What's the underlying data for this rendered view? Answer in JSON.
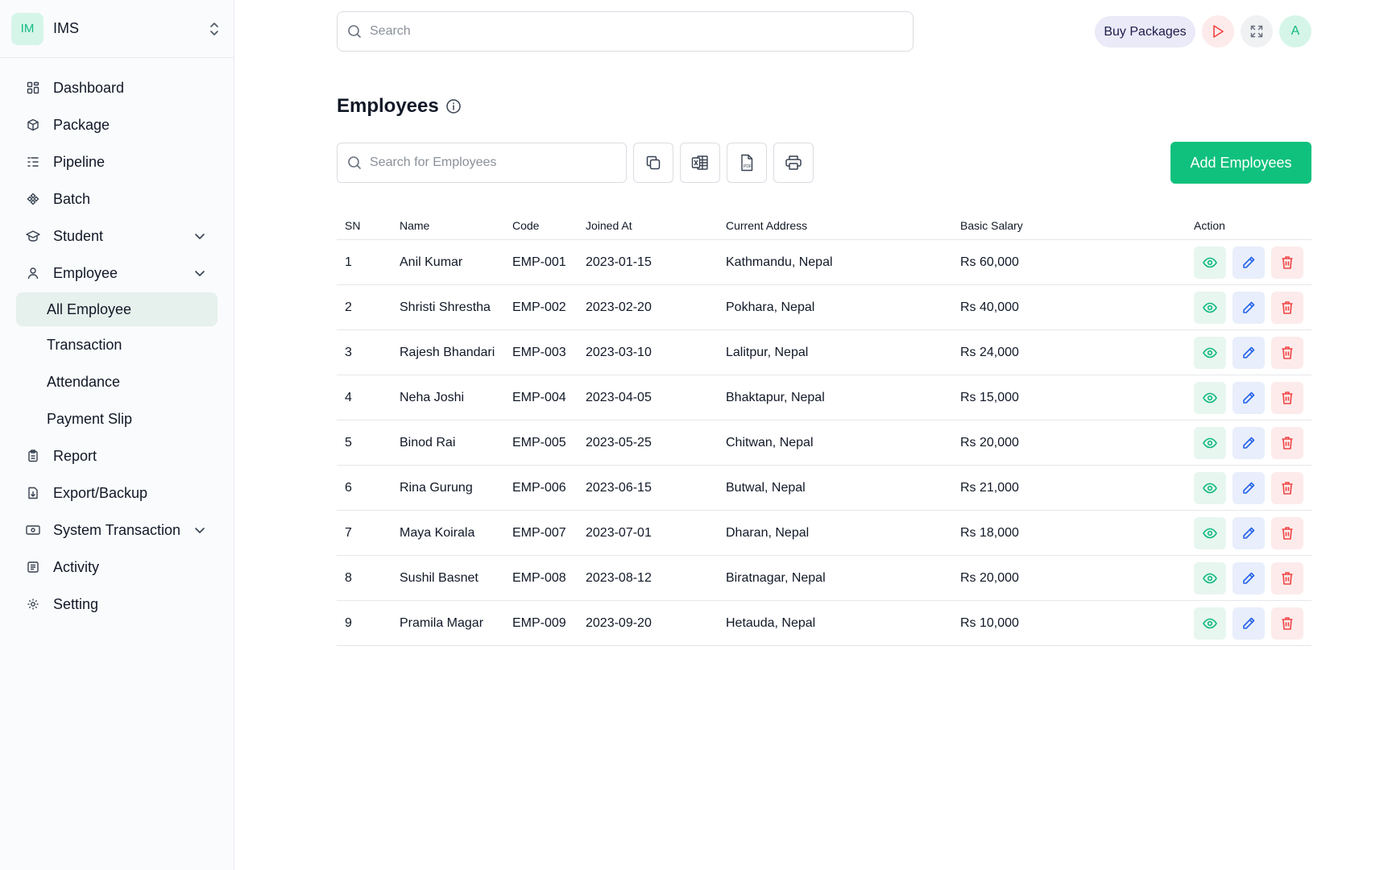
{
  "brand": {
    "badge": "IM",
    "name": "IMS"
  },
  "sidebar": {
    "items": [
      {
        "label": "Dashboard"
      },
      {
        "label": "Package"
      },
      {
        "label": "Pipeline"
      },
      {
        "label": "Batch"
      },
      {
        "label": "Student"
      },
      {
        "label": "Employee"
      },
      {
        "label": "Report"
      },
      {
        "label": "Export/Backup"
      },
      {
        "label": "System Transaction"
      },
      {
        "label": "Activity"
      },
      {
        "label": "Setting"
      }
    ],
    "employee_sub": [
      {
        "label": "All Employee"
      },
      {
        "label": "Transaction"
      },
      {
        "label": "Attendance"
      },
      {
        "label": "Payment Slip"
      }
    ]
  },
  "header": {
    "search_placeholder": "Search",
    "buy_label": "Buy Packages",
    "avatar_initial": "A"
  },
  "page": {
    "title": "Employees",
    "search_placeholder": "Search for Employees",
    "add_label": "Add Employees"
  },
  "table": {
    "headers": [
      "SN",
      "Name",
      "Code",
      "Joined At",
      "Current Address",
      "Basic Salary",
      "Action"
    ],
    "rows": [
      {
        "sn": "1",
        "name": "Anil Kumar",
        "code": "EMP-001",
        "joined": "2023-01-15",
        "address": "Kathmandu, Nepal",
        "salary": "Rs 60,000"
      },
      {
        "sn": "2",
        "name": "Shristi Shrestha",
        "code": "EMP-002",
        "joined": "2023-02-20",
        "address": "Pokhara, Nepal",
        "salary": "Rs 40,000"
      },
      {
        "sn": "3",
        "name": "Rajesh Bhandari",
        "code": "EMP-003",
        "joined": "2023-03-10",
        "address": "Lalitpur, Nepal",
        "salary": "Rs 24,000"
      },
      {
        "sn": "4",
        "name": "Neha Joshi",
        "code": "EMP-004",
        "joined": "2023-04-05",
        "address": "Bhaktapur, Nepal",
        "salary": "Rs 15,000"
      },
      {
        "sn": "5",
        "name": "Binod Rai",
        "code": "EMP-005",
        "joined": "2023-05-25",
        "address": "Chitwan, Nepal",
        "salary": "Rs 20,000"
      },
      {
        "sn": "6",
        "name": "Rina Gurung",
        "code": "EMP-006",
        "joined": "2023-06-15",
        "address": "Butwal, Nepal",
        "salary": "Rs 21,000"
      },
      {
        "sn": "7",
        "name": "Maya Koirala",
        "code": "EMP-007",
        "joined": "2023-07-01",
        "address": "Dharan, Nepal",
        "salary": "Rs 18,000"
      },
      {
        "sn": "8",
        "name": "Sushil Basnet",
        "code": "EMP-008",
        "joined": "2023-08-12",
        "address": "Biratnagar, Nepal",
        "salary": "Rs 20,000"
      },
      {
        "sn": "9",
        "name": "Pramila Magar",
        "code": "EMP-009",
        "joined": "2023-09-20",
        "address": "Hetauda, Nepal",
        "salary": "Rs 10,000"
      }
    ]
  },
  "colors": {
    "accent": "#10c17d",
    "view": "#10b981",
    "edit": "#2563eb",
    "delete": "#ef4444"
  }
}
